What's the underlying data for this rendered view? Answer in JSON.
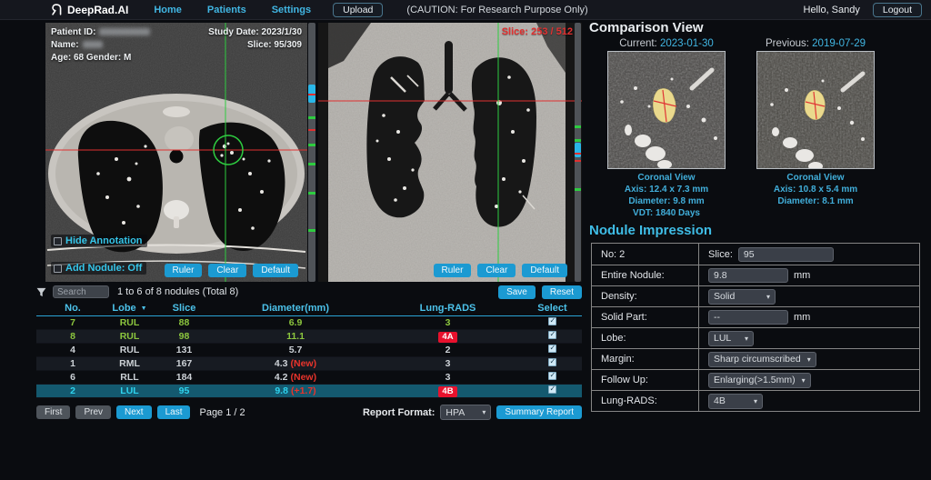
{
  "navbar": {
    "brand": "DeepRad.AI",
    "links": [
      "Home",
      "Patients",
      "Settings"
    ],
    "upload": "Upload",
    "caution": "(CAUTION: For Research Purpose Only)",
    "greeting": "Hello, Sandy",
    "logout": "Logout"
  },
  "axial": {
    "patient_id_label": "Patient ID:",
    "name_label": "Name:",
    "age_gender": "Age: 68 Gender: M",
    "study_date": "Study Date: 2023/1/30",
    "slice": "Slice: 95/309",
    "hide_annotation": "Hide Annotation",
    "add_nodule": "Add Nodule: Off",
    "ruler": "Ruler",
    "clear": "Clear",
    "default": "Default"
  },
  "coronal": {
    "slice": "Slice: 253 / 512",
    "ruler": "Ruler",
    "clear": "Clear",
    "default": "Default"
  },
  "comparison": {
    "title": "Comparison View",
    "current_label": "Current:",
    "current_date": "2023-01-30",
    "previous_label": "Previous:",
    "previous_date": "2019-07-29",
    "current_info": {
      "view": "Coronal View",
      "axis": "Axis: 12.4 x 7.3 mm",
      "diameter": "Diameter: 9.8 mm",
      "vdt": "VDT: 1840 Days"
    },
    "previous_info": {
      "view": "Coronal View",
      "axis": "Axis: 10.8 x 5.4 mm",
      "diameter": "Diameter: 8.1 mm"
    }
  },
  "impression": {
    "title": "Nodule Impression",
    "no": "No: 2",
    "slice_label": "Slice:",
    "slice_value": "95",
    "entire_label": "Entire Nodule:",
    "entire_value": "9.8",
    "entire_unit": "mm",
    "density_label": "Density:",
    "density_value": "Solid",
    "solid_label": "Solid Part:",
    "solid_value": "--",
    "solid_unit": "mm",
    "lobe_label": "Lobe:",
    "lobe_value": "LUL",
    "margin_label": "Margin:",
    "margin_value": "Sharp circumscribed",
    "followup_label": "Follow Up:",
    "followup_value": "Enlarging(>1.5mm)",
    "lungrads_label": "Lung-RADS:",
    "lungrads_value": "4B"
  },
  "nodules": {
    "search_placeholder": "Search",
    "summary": "1 to 6 of 8 nodules (Total 8)",
    "save": "Save",
    "reset": "Reset",
    "columns": [
      "No.",
      "Lobe",
      "Slice",
      "Diameter(mm)",
      "Lung-RADS",
      "Select"
    ],
    "rows": [
      {
        "no": "7",
        "lobe": "RUL",
        "slice": "88",
        "diameter": "6.9",
        "note": "",
        "lungrads": "3",
        "badge": false,
        "tone": "green",
        "selected": false,
        "checked": true
      },
      {
        "no": "8",
        "lobe": "RUL",
        "slice": "98",
        "diameter": "11.1",
        "note": "",
        "lungrads": "4A",
        "badge": true,
        "tone": "green",
        "selected": false,
        "checked": true
      },
      {
        "no": "4",
        "lobe": "RUL",
        "slice": "131",
        "diameter": "5.7",
        "note": "",
        "lungrads": "2",
        "badge": false,
        "tone": "plain",
        "selected": false,
        "checked": true
      },
      {
        "no": "1",
        "lobe": "RML",
        "slice": "167",
        "diameter": "4.3",
        "note": "(New)",
        "lungrads": "3",
        "badge": false,
        "tone": "plain",
        "selected": false,
        "checked": true
      },
      {
        "no": "6",
        "lobe": "RLL",
        "slice": "184",
        "diameter": "4.2",
        "note": "(New)",
        "lungrads": "3",
        "badge": false,
        "tone": "plain",
        "selected": false,
        "checked": true
      },
      {
        "no": "2",
        "lobe": "LUL",
        "slice": "95",
        "diameter": "9.8",
        "note": "(+1.7)",
        "lungrads": "4B",
        "badge": true,
        "tone": "selected",
        "selected": true,
        "checked": true
      }
    ]
  },
  "pagination": {
    "first": "First",
    "prev": "Prev",
    "next": "Next",
    "last": "Last",
    "page": "Page 1 / 2"
  },
  "report": {
    "label": "Report Format:",
    "format": "HPA",
    "button": "Summary Report"
  },
  "colors": {
    "accent": "#1b9ad2",
    "cyan_text": "#41b6e3",
    "green_row": "#8cc63e",
    "alert_red": "#e8112d",
    "selected_row": "#14596f"
  }
}
